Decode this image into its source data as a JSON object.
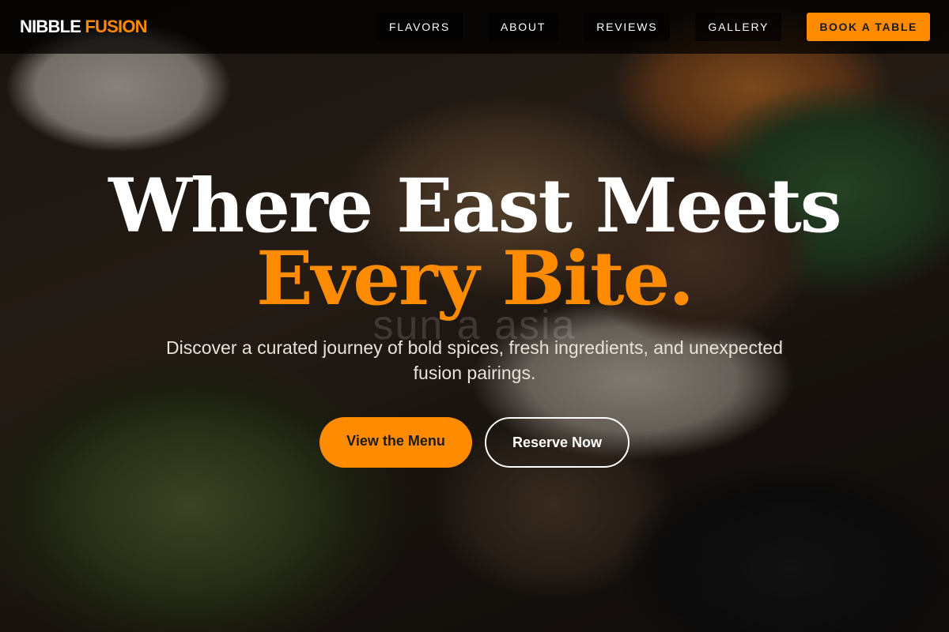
{
  "brand": {
    "name_primary": "NIBBLE",
    "name_accent": "FUSION"
  },
  "nav": {
    "links": [
      {
        "label": "FLAVORS"
      },
      {
        "label": "ABOUT"
      },
      {
        "label": "REVIEWS"
      },
      {
        "label": "GALLERY"
      }
    ],
    "cta_label": "BOOK A TABLE"
  },
  "hero": {
    "title_line1": "Where East Meets",
    "title_line2": "Every Bite.",
    "ghost_text": "sun a asia",
    "subtitle": "Discover a curated journey of bold spices, fresh ingredients, and unexpected fusion pairings.",
    "primary_button": "View the Menu",
    "secondary_button": "Reserve Now"
  },
  "colors": {
    "accent": "#ff8c00",
    "nav_background": "#000000",
    "text": "#ffffff"
  }
}
